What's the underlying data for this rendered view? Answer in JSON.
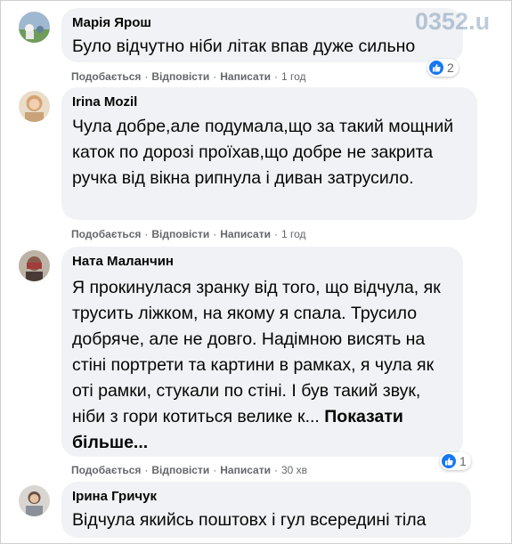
{
  "actions": {
    "like": "Подобається",
    "reply": "Відповісти",
    "write": "Написати",
    "separator": "·"
  },
  "watermark": "0352.u",
  "colors": {
    "bubble": "#f0f2f5",
    "like": "#1877f2",
    "meta": "#65676b"
  },
  "comments": [
    {
      "author": "Марія Ярош",
      "text": "Було відчутно ніби літак впав дуже сильно",
      "time": "1 год",
      "reactions": "2",
      "reaction_icon": "like-icon"
    },
    {
      "author": "Irina Mozil",
      "text": "Чула добре,але подумала,що за такий мощний каток по дорозі проїхав,що добре не закрита ручка від вікна рипнула і диван затрусило.",
      "time": "1 год"
    },
    {
      "author": "Ната Маланчин",
      "text": "Я прокинулася зранку від того, що відчула, як трусить ліжком, на якому я спала. Трусило добряче, але не довго. Надімною висять на стіні портрети та картини в рамках, я чула як оті рамки, стукали по стіні. І був такий звук, ніби з гори котиться велике к...",
      "see_more": "Показати більше...",
      "time": "30 хв",
      "reactions": "1",
      "reaction_icon": "like-icon"
    },
    {
      "author": "Ірина Гричук",
      "text": "Відчула якийсь поштовх і гул всередині тіла"
    }
  ]
}
